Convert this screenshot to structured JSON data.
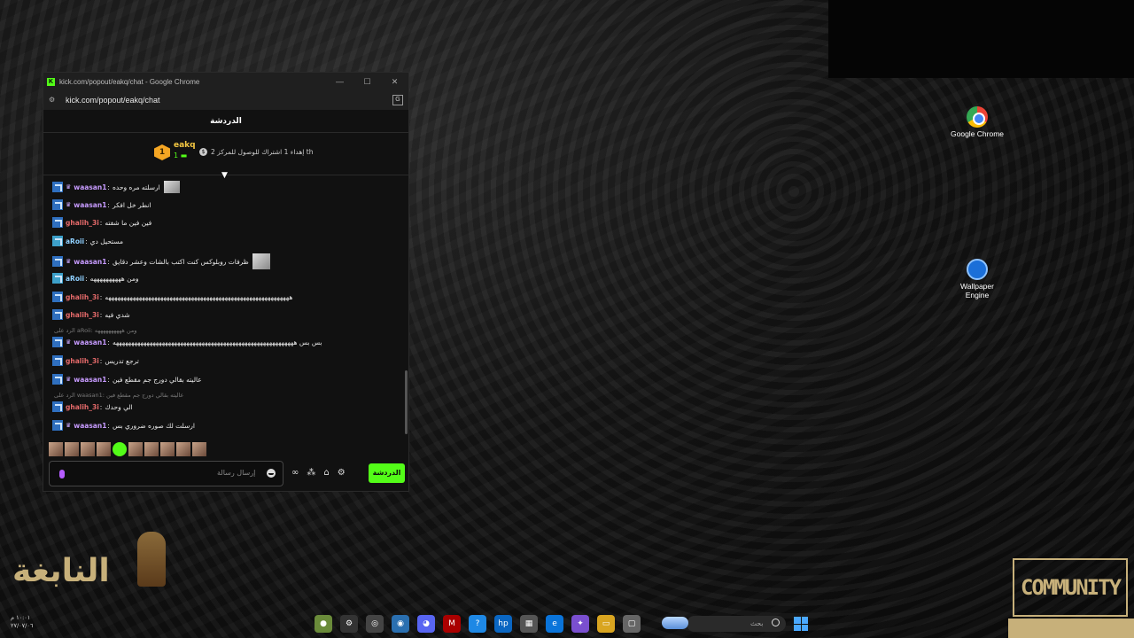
{
  "window": {
    "title": "kick.com/popout/eakq/chat - Google Chrome",
    "url": "kick.com/popout/eakq/chat",
    "controls": [
      "—",
      "☐",
      "✕"
    ]
  },
  "chat": {
    "header": "الدردشة",
    "pinned": {
      "rank_badge": "1",
      "username": "eakq",
      "rank_line": "1 ▬",
      "info": "إهداء 1 اشتراك للوصول للمركز 2 th",
      "info_icon": "$"
    },
    "messages": [
      {
        "user": "waasan1",
        "crown": "♛",
        "sep": ":",
        "text": "ارسلته مره وحده",
        "thumb": true
      },
      {
        "user": "waasan1",
        "crown": "♛",
        "sep": ":",
        "text": "انطر خل افكر"
      },
      {
        "user": "ghalih_3i",
        "sep": ":",
        "text": "فين فين ما شفته"
      },
      {
        "user": "aRoii",
        "sep": ":",
        "text": "مستحيل دي"
      },
      {
        "user": "waasan1",
        "crown": "♛",
        "sep": ":",
        "text": "ظرفات روبلوكس كنت اكتب بالشات وعشر دقايق",
        "thumb": true
      },
      {
        "user": "aRoii",
        "sep": ":",
        "text": "ومن ههههههههههه"
      },
      {
        "user": "ghalih_3i",
        "sep": ":",
        "text": "ههههههههههههههههههههههههههههههههههههههههههههههههههههههههههههه"
      },
      {
        "user": "ghalih_3i",
        "sep": ":",
        "text": "شدي فيه"
      },
      {
        "reply": "الرد على aRoii: ومن ههههههههههه"
      },
      {
        "user": "waasan1",
        "crown": "♛",
        "sep": ":",
        "text": "بس بس هههههههههههههههههههههههههههههههههههههههههههههههههههههههههههه"
      },
      {
        "user": "ghalih_3i",
        "sep": ":",
        "text": "ترجع تدريس"
      },
      {
        "user": "waasan1",
        "crown": "♛",
        "sep": ":",
        "text": "عاليته بقالي دورج جم مقطع فين"
      },
      {
        "reply": "الرد على waasan1: عاليته بقالي دورج جم مقطع فين"
      },
      {
        "user": "ghalih_3i",
        "sep": ":",
        "text": "الي وحدك"
      },
      {
        "user": "waasan1",
        "crown": "♛",
        "sep": ":",
        "text": "ارسلت لك صوره ضروري بس"
      }
    ],
    "input_placeholder": "إرسال رسالة",
    "send_label": "الدردشة"
  },
  "desktop": {
    "icons": [
      {
        "label": "Google Chrome",
        "icon": "chrome-icon"
      },
      {
        "label": "Wallpaper Engine",
        "icon": "wallpaper-engine-icon"
      }
    ],
    "watermark_left": "النابغة",
    "watermark_right": "COMMUNITY",
    "clock_time": "١٠:٠١ م",
    "clock_date": "٢٧/٠٧/٠٦"
  },
  "taskbar": {
    "search_placeholder": "بحث"
  },
  "colors": {
    "kick_green": "#53fc18",
    "waasan_color": "#c79bff",
    "ghalih_color": "#e56a6a",
    "aroii_color": "#8fd0ff",
    "watermark_gold": "#c7b07a"
  }
}
